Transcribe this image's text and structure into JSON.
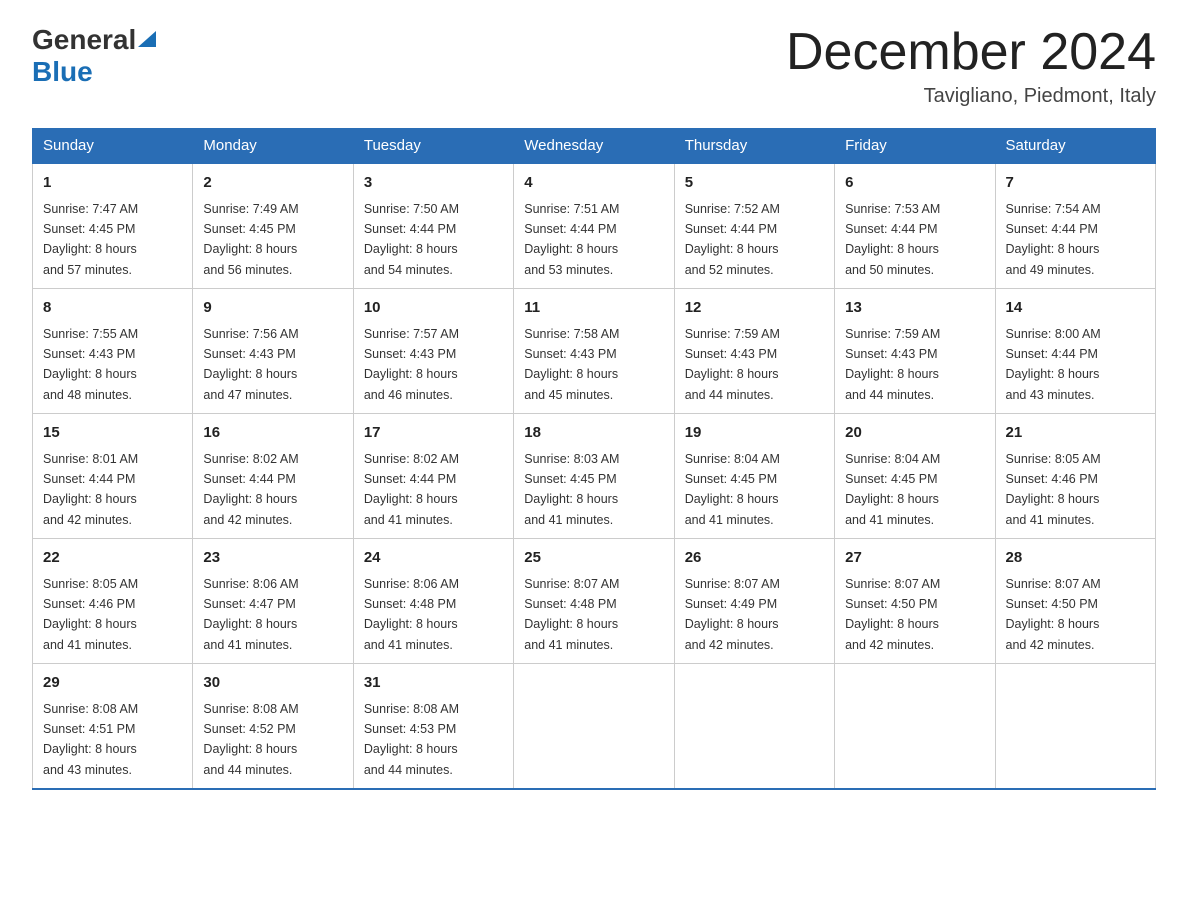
{
  "logo": {
    "general": "General",
    "blue": "Blue"
  },
  "header": {
    "month": "December 2024",
    "location": "Tavigliano, Piedmont, Italy"
  },
  "days_of_week": [
    "Sunday",
    "Monday",
    "Tuesday",
    "Wednesday",
    "Thursday",
    "Friday",
    "Saturday"
  ],
  "weeks": [
    [
      {
        "day": "1",
        "sunrise": "7:47 AM",
        "sunset": "4:45 PM",
        "daylight": "8 hours and 57 minutes."
      },
      {
        "day": "2",
        "sunrise": "7:49 AM",
        "sunset": "4:45 PM",
        "daylight": "8 hours and 56 minutes."
      },
      {
        "day": "3",
        "sunrise": "7:50 AM",
        "sunset": "4:44 PM",
        "daylight": "8 hours and 54 minutes."
      },
      {
        "day": "4",
        "sunrise": "7:51 AM",
        "sunset": "4:44 PM",
        "daylight": "8 hours and 53 minutes."
      },
      {
        "day": "5",
        "sunrise": "7:52 AM",
        "sunset": "4:44 PM",
        "daylight": "8 hours and 52 minutes."
      },
      {
        "day": "6",
        "sunrise": "7:53 AM",
        "sunset": "4:44 PM",
        "daylight": "8 hours and 50 minutes."
      },
      {
        "day": "7",
        "sunrise": "7:54 AM",
        "sunset": "4:44 PM",
        "daylight": "8 hours and 49 minutes."
      }
    ],
    [
      {
        "day": "8",
        "sunrise": "7:55 AM",
        "sunset": "4:43 PM",
        "daylight": "8 hours and 48 minutes."
      },
      {
        "day": "9",
        "sunrise": "7:56 AM",
        "sunset": "4:43 PM",
        "daylight": "8 hours and 47 minutes."
      },
      {
        "day": "10",
        "sunrise": "7:57 AM",
        "sunset": "4:43 PM",
        "daylight": "8 hours and 46 minutes."
      },
      {
        "day": "11",
        "sunrise": "7:58 AM",
        "sunset": "4:43 PM",
        "daylight": "8 hours and 45 minutes."
      },
      {
        "day": "12",
        "sunrise": "7:59 AM",
        "sunset": "4:43 PM",
        "daylight": "8 hours and 44 minutes."
      },
      {
        "day": "13",
        "sunrise": "7:59 AM",
        "sunset": "4:43 PM",
        "daylight": "8 hours and 44 minutes."
      },
      {
        "day": "14",
        "sunrise": "8:00 AM",
        "sunset": "4:44 PM",
        "daylight": "8 hours and 43 minutes."
      }
    ],
    [
      {
        "day": "15",
        "sunrise": "8:01 AM",
        "sunset": "4:44 PM",
        "daylight": "8 hours and 42 minutes."
      },
      {
        "day": "16",
        "sunrise": "8:02 AM",
        "sunset": "4:44 PM",
        "daylight": "8 hours and 42 minutes."
      },
      {
        "day": "17",
        "sunrise": "8:02 AM",
        "sunset": "4:44 PM",
        "daylight": "8 hours and 41 minutes."
      },
      {
        "day": "18",
        "sunrise": "8:03 AM",
        "sunset": "4:45 PM",
        "daylight": "8 hours and 41 minutes."
      },
      {
        "day": "19",
        "sunrise": "8:04 AM",
        "sunset": "4:45 PM",
        "daylight": "8 hours and 41 minutes."
      },
      {
        "day": "20",
        "sunrise": "8:04 AM",
        "sunset": "4:45 PM",
        "daylight": "8 hours and 41 minutes."
      },
      {
        "day": "21",
        "sunrise": "8:05 AM",
        "sunset": "4:46 PM",
        "daylight": "8 hours and 41 minutes."
      }
    ],
    [
      {
        "day": "22",
        "sunrise": "8:05 AM",
        "sunset": "4:46 PM",
        "daylight": "8 hours and 41 minutes."
      },
      {
        "day": "23",
        "sunrise": "8:06 AM",
        "sunset": "4:47 PM",
        "daylight": "8 hours and 41 minutes."
      },
      {
        "day": "24",
        "sunrise": "8:06 AM",
        "sunset": "4:48 PM",
        "daylight": "8 hours and 41 minutes."
      },
      {
        "day": "25",
        "sunrise": "8:07 AM",
        "sunset": "4:48 PM",
        "daylight": "8 hours and 41 minutes."
      },
      {
        "day": "26",
        "sunrise": "8:07 AM",
        "sunset": "4:49 PM",
        "daylight": "8 hours and 42 minutes."
      },
      {
        "day": "27",
        "sunrise": "8:07 AM",
        "sunset": "4:50 PM",
        "daylight": "8 hours and 42 minutes."
      },
      {
        "day": "28",
        "sunrise": "8:07 AM",
        "sunset": "4:50 PM",
        "daylight": "8 hours and 42 minutes."
      }
    ],
    [
      {
        "day": "29",
        "sunrise": "8:08 AM",
        "sunset": "4:51 PM",
        "daylight": "8 hours and 43 minutes."
      },
      {
        "day": "30",
        "sunrise": "8:08 AM",
        "sunset": "4:52 PM",
        "daylight": "8 hours and 44 minutes."
      },
      {
        "day": "31",
        "sunrise": "8:08 AM",
        "sunset": "4:53 PM",
        "daylight": "8 hours and 44 minutes."
      },
      null,
      null,
      null,
      null
    ]
  ],
  "labels": {
    "sunrise": "Sunrise:",
    "sunset": "Sunset:",
    "daylight": "Daylight:"
  }
}
